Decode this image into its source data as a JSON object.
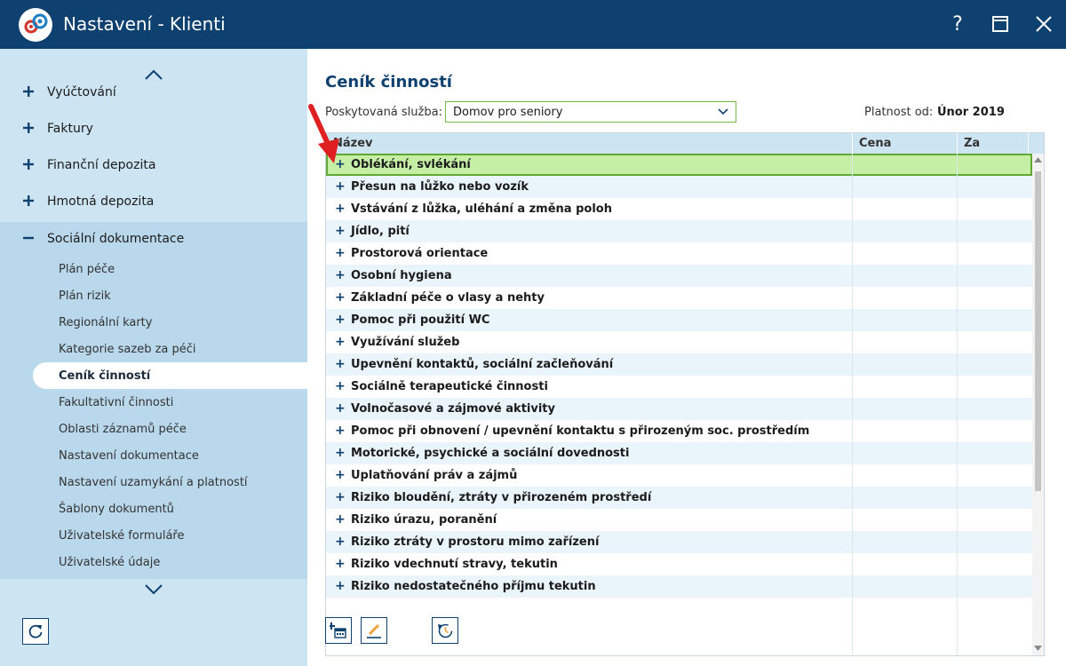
{
  "window": {
    "title": "Nastavení - Klienti",
    "help_label": "?"
  },
  "sidebar": {
    "items": [
      {
        "label": "Vyúčtování",
        "sign": "plus"
      },
      {
        "label": "Faktury",
        "sign": "plus"
      },
      {
        "label": "Finanční depozita",
        "sign": "plus"
      },
      {
        "label": "Hmotná depozita",
        "sign": "plus"
      },
      {
        "label": "Sociální dokumentace",
        "sign": "minus"
      }
    ],
    "subitems": [
      "Plán péče",
      "Plán rizik",
      "Regionální karty",
      "Kategorie sazeb za péči",
      "Ceník činností",
      "Fakultativní činnosti",
      "Oblasti záznamů péče",
      "Nastavení dokumentace",
      "Nastavení uzamykání a platností",
      "Šablony dokumentů",
      "Uživatelské formuláře",
      "Uživatelské údaje"
    ],
    "active_subitem": "Ceník činností"
  },
  "main": {
    "title": "Ceník činností",
    "service_label": "Poskytovaná služba:",
    "service_value": "Domov pro seniory",
    "validity_label": "Platnost od:",
    "validity_value": "Únor 2019",
    "grid": {
      "columns": [
        "Název",
        "Cena",
        "Za"
      ],
      "rows": [
        "Oblékání, svlékání",
        "Přesun na lůžko nebo vozík",
        "Vstávání z lůžka, uléhání a změna poloh",
        "Jídlo, pití",
        "Prostorová orientace",
        "Osobní hygiena",
        "Základní péče o vlasy a nehty",
        "Pomoc při použití WC",
        "Využívání služeb",
        "Upevnění kontaktů, sociální začleňování",
        "Sociálně terapeutické činnosti",
        "Volnočasové a zájmové aktivity",
        "Pomoc při obnovení / upevnění kontaktu s přirozeným soc. prostředím",
        "Motorické, psychické a sociální dovednosti",
        "Uplatňování práv a zájmů",
        "Riziko bloudění, ztráty v přirozeném prostředí",
        "Riziko úrazu, poranění",
        "Riziko ztráty v prostoru mimo zařízení",
        "Riziko vdechnutí stravy, tekutin",
        "Riziko nedostatečného příjmu tekutin"
      ],
      "selected_row": "Oblékání, svlékání",
      "expand_symbol": "+"
    }
  },
  "colors": {
    "titlebar": "#0e4170",
    "sidebar": "#cde4f2",
    "selected_row": "#c6efa6",
    "annotation_arrow": "#e02020"
  },
  "icons": [
    "app-logo-gears",
    "help-icon",
    "maximize-icon",
    "close-icon",
    "chevron-up-icon",
    "chevron-down-icon",
    "refresh-icon",
    "add-calendar-icon",
    "edit-pencil-icon",
    "history-clock-icon"
  ]
}
